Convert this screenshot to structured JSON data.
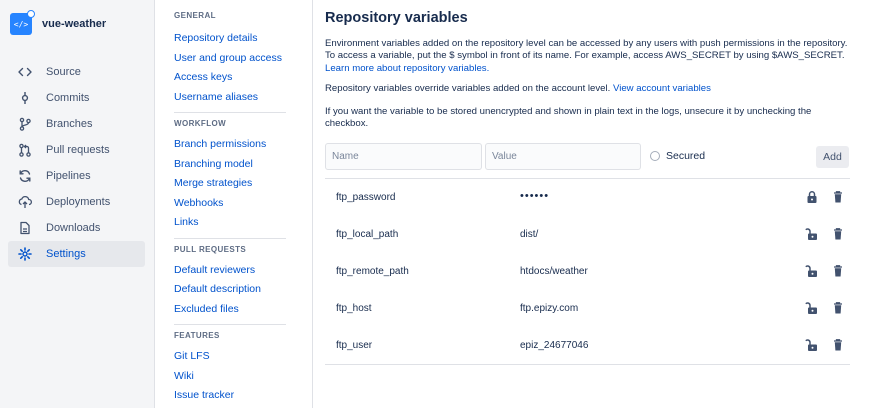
{
  "repo": {
    "name": "vue-weather",
    "avatar_glyph": "</>"
  },
  "nav": [
    {
      "label": "Source",
      "icon": "code-icon"
    },
    {
      "label": "Commits",
      "icon": "commit-icon"
    },
    {
      "label": "Branches",
      "icon": "branch-icon"
    },
    {
      "label": "Pull requests",
      "icon": "pull-request-icon"
    },
    {
      "label": "Pipelines",
      "icon": "pipelines-icon"
    },
    {
      "label": "Deployments",
      "icon": "deployments-icon"
    },
    {
      "label": "Downloads",
      "icon": "downloads-icon"
    },
    {
      "label": "Settings",
      "icon": "gear-icon",
      "active": true
    }
  ],
  "subnav": {
    "general": {
      "heading": "GENERAL",
      "items": [
        "Repository details",
        "User and group access",
        "Access keys",
        "Username aliases"
      ]
    },
    "workflow": {
      "heading": "WORKFLOW",
      "items": [
        "Branch permissions",
        "Branching model",
        "Merge strategies",
        "Webhooks",
        "Links"
      ]
    },
    "pull_requests": {
      "heading": "PULL REQUESTS",
      "items": [
        "Default reviewers",
        "Default description",
        "Excluded files"
      ]
    },
    "features": {
      "heading": "FEATURES",
      "items": [
        "Git LFS",
        "Wiki",
        "Issue tracker"
      ]
    }
  },
  "main": {
    "title": "Repository variables",
    "intro": "Environment variables added on the repository level can be accessed by any users with push permissions in the repository. To access a variable, put the $ symbol in front of its name. For example, access AWS_SECRET by using $AWS_SECRET.",
    "learn_more": "Learn more about repository variables.",
    "override_text": "Repository variables override variables added on the account level.",
    "view_account": "View account variables",
    "secured_note": "If you want the variable to be stored unencrypted and shown in plain text in the logs, unsecure it by unchecking the checkbox.",
    "name_placeholder": "Name",
    "value_placeholder": "Value",
    "secured_label": "Secured",
    "add_label": "Add",
    "variables": [
      {
        "name": "ftp_password",
        "value": "••••••",
        "secured": true
      },
      {
        "name": "ftp_local_path",
        "value": "dist/",
        "secured": false
      },
      {
        "name": "ftp_remote_path",
        "value": "htdocs/weather",
        "secured": false
      },
      {
        "name": "ftp_host",
        "value": "ftp.epizy.com",
        "secured": false
      },
      {
        "name": "ftp_user",
        "value": "epiz_24677046",
        "secured": false
      }
    ]
  },
  "colors": {
    "accent": "#0052cc",
    "avatar": "#2684ff",
    "sidebar_bg": "#f4f5f7"
  }
}
